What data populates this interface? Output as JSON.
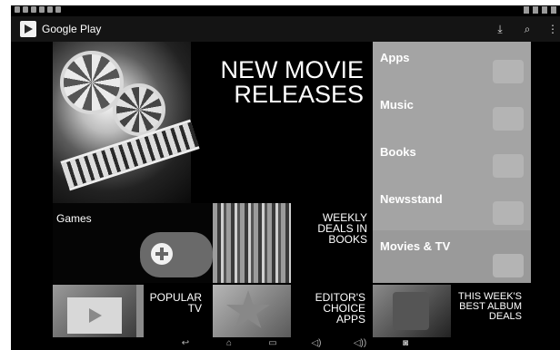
{
  "actionbar": {
    "title": "Google Play",
    "icons": [
      "play-store-logo-icon",
      "download-icon",
      "search-icon",
      "overflow-menu-icon"
    ],
    "download_glyph": "⤓",
    "search_glyph": "⌕",
    "menu_glyph": "⋮"
  },
  "hero": {
    "line1": "NEW MOVIE",
    "line2": "RELEASES"
  },
  "nav": {
    "items": [
      {
        "label": "Apps",
        "icon": "android-icon"
      },
      {
        "label": "Music",
        "icon": "headphones-icon"
      },
      {
        "label": "Books",
        "icon": "open-book-icon"
      },
      {
        "label": "Newsstand",
        "icon": "newspaper-icon"
      },
      {
        "label": "Movies & TV",
        "icon": "film-icon"
      }
    ]
  },
  "tiles": {
    "games": "Games",
    "books": {
      "line1": "WEEKLY",
      "line2": "DEALS IN",
      "line3": "BOOKS"
    },
    "tv": {
      "line1": "POPULAR",
      "line2": "TV"
    },
    "apps": {
      "line1": "EDITOR'S",
      "line2": "CHOICE",
      "line3": "APPS"
    },
    "album": {
      "line1": "THIS WEEK'S",
      "line2": "BEST ALBUM",
      "line3": "DEALS"
    }
  },
  "navbar": {
    "back_glyph": "↩",
    "home_glyph": "⌂",
    "recents_glyph": "▭",
    "vol_down_glyph": "◁)",
    "vol_up_glyph": "◁))",
    "screenshot_glyph": "◙"
  },
  "colors": {
    "nav_panel": "#a4a4a4",
    "background": "#000000",
    "action_bar": "#141414"
  }
}
